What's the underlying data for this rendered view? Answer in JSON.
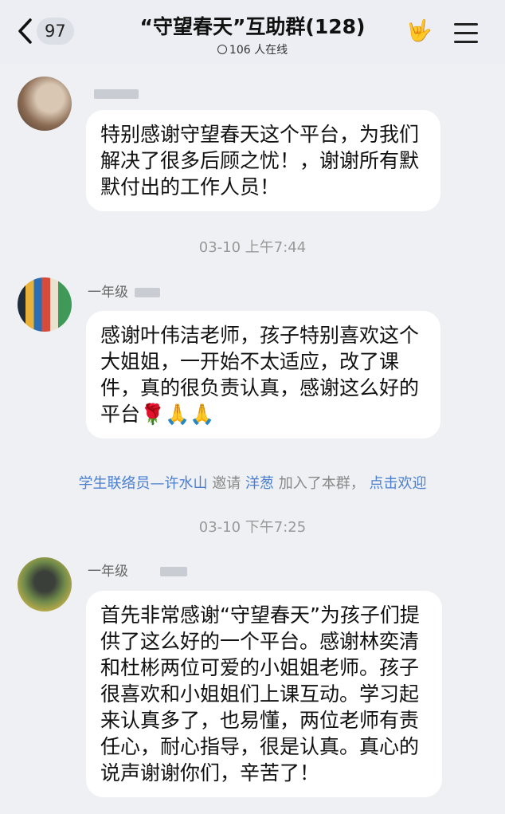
{
  "header": {
    "back_count": "97",
    "title": "“守望春天”互助群(128)",
    "online": "106 人在线",
    "hand_icon": "🤟"
  },
  "messages": [
    {
      "name": "",
      "text": "特别感谢守望春天这个平台，为我们解决了很多后顾之忧！，谢谢所有默默付出的工作人员！"
    },
    {
      "name": "一年级",
      "text": "感谢叶伟洁老师，孩子特别喜欢这个大姐姐，一开始不太适应，改了课件，真的很负责认真，感谢这么好的平台🌹🙏🙏"
    },
    {
      "name": "一年级",
      "text": "首先非常感谢“守望春天”为孩子们提供了这么好的一个平台。感谢林奕清和杜彬两位可爱的小姐姐老师。孩子很喜欢和小姐姐们上课互动。学习起来认真多了，也易懂，两位老师有责任心，耐心指导，很是认真。真心的说声谢谢你们，辛苦了！"
    }
  ],
  "times": {
    "t1": "03-10 上午7:44",
    "t2": "03-10 下午7:25"
  },
  "system": {
    "inviter": "学生联络员—许水山",
    "invite_word": "邀请",
    "invitee": "洋葱",
    "joined": "加入了本群，",
    "welcome": "点击欢迎"
  }
}
